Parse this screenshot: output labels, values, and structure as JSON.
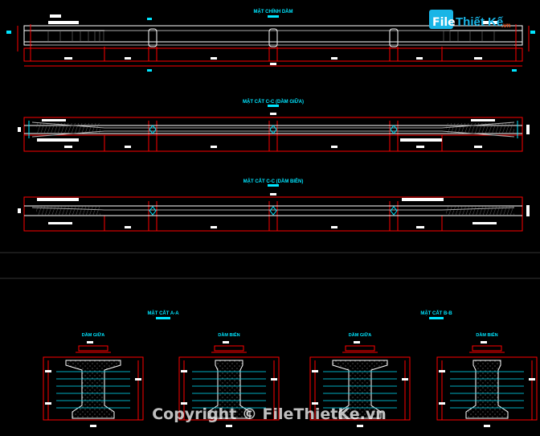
{
  "elevation": {
    "title": "MẶT CHÍNH DẦM"
  },
  "section_cc_mid": {
    "title": "MẶT CẮT C-C (DẦM GIỮA)"
  },
  "section_cc_edge": {
    "title": "MẶT CẮT C-C (DẦM BIÊN)"
  },
  "section_aa": {
    "title": "MẶT CẮT A-A",
    "left_label": "DẦM GIỮA",
    "right_label": "DẦM BIÊN"
  },
  "section_bb": {
    "title": "MẶT CẮT B-B",
    "left_label": "DẦM GIỮA",
    "right_label": "DẦM BIÊN"
  },
  "watermark": {
    "copyright": "Copyright © FileThietKe.vn",
    "logo_file": "File",
    "logo_rest": "Thiết Kế",
    "logo_vn": ".vn"
  },
  "colors": {
    "background": "#000000",
    "dim": "#ff0000",
    "outline": "#ffffff",
    "label": "#00e5ff"
  }
}
